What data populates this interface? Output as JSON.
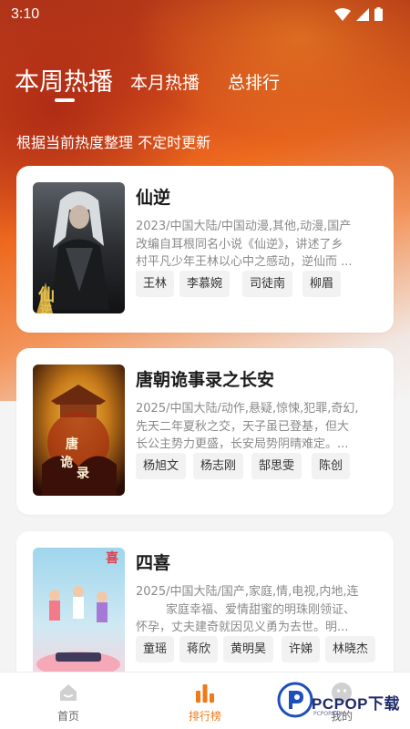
{
  "status_bar": {
    "time": "3:10"
  },
  "tabs": [
    {
      "label": "本周热播",
      "active": true
    },
    {
      "label": "本月热播",
      "active": false
    },
    {
      "label": "总排行",
      "active": false
    }
  ],
  "subtitle": "根据当前热度整理 不定时更新",
  "cards": [
    {
      "title": "仙逆",
      "meta": "2023/中国大陆/中国动漫,其他,动漫,国产",
      "desc_lines": [
        "改编自耳根同名小说《仙逆》，讲述了乡",
        "村平凡少年王林以心中之感动，逆仙而 ..."
      ],
      "cast": [
        "王林",
        "李慕婉",
        "司徒南",
        "柳眉"
      ]
    },
    {
      "title": "唐朝诡事录之长安",
      "meta": "2025/中国大陆/动作,悬疑,惊悚,犯罪,奇幻,",
      "desc_lines": [
        "先天二年夏秋之交，天子虽已登基，但大",
        "长公主势力更盛，长安局势阴晴难定。..."
      ],
      "cast": [
        "杨旭文",
        "杨志刚",
        "郜思雯",
        "陈创"
      ]
    },
    {
      "title": "四喜",
      "meta": "2025/中国大陆/国产,家庭,情,电视,内地,连",
      "desc_lines": [
        "        家庭幸福、爱情甜蜜的明珠刚领证、",
        "怀孕，丈夫建奇就因见义勇为去世。明..."
      ],
      "cast": [
        "童瑶",
        "蒋欣",
        "黄明昊",
        "许娣",
        "林晓杰"
      ]
    }
  ],
  "bottom_nav": [
    {
      "label": "首页",
      "icon": "home-icon",
      "active": false
    },
    {
      "label": "排行榜",
      "icon": "ranking-bar-icon",
      "active": true
    },
    {
      "label": "我的",
      "icon": "profile-icon",
      "active": false
    }
  ],
  "watermark": {
    "brand": "PCPOP下载",
    "sub": "PCPOP.COM"
  },
  "colors": {
    "accent": "#f07a1a",
    "card_bg": "#ffffff",
    "chip_bg": "#f2f2f2"
  }
}
